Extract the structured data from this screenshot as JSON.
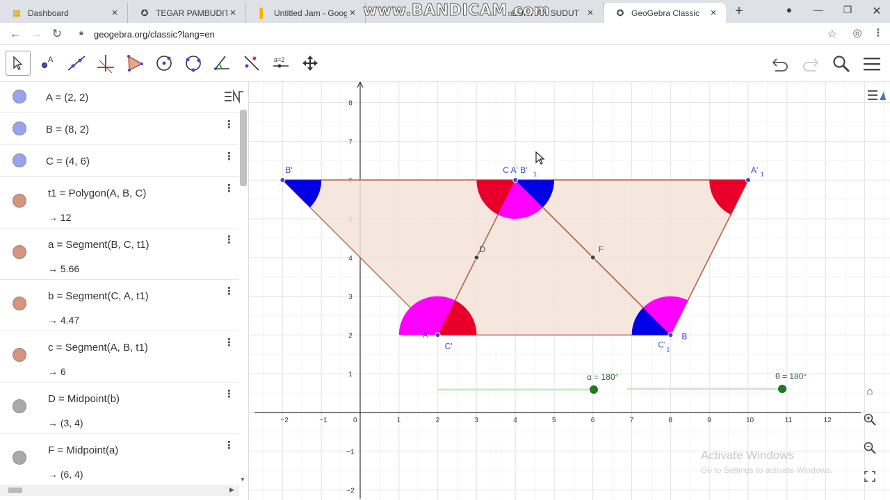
{
  "browser": {
    "tabs": [
      {
        "title": "Dashboard",
        "icon": "dashboard-icon",
        "glyph": "▦",
        "color": "#e0a800"
      },
      {
        "title": "TEGAR PAMBUDITAMA",
        "icon": "geogebra-icon",
        "glyph": "✪",
        "color": "#555555"
      },
      {
        "title": "Untitled Jam - Google",
        "icon": "jamboard-icon",
        "glyph": "▌",
        "color": "#f4b400"
      },
      {
        "title": "BUKTIAN SUDUT",
        "icon": "geogebra-icon",
        "glyph": "✪",
        "color": "#555555"
      },
      {
        "title": "GeoGebra Classic",
        "icon": "geogebra-icon",
        "glyph": "✪",
        "color": "#555555"
      }
    ],
    "watermark": "www.BANDICAM.com",
    "url": "geogebra.org/classic?lang=en"
  },
  "algebra": [
    {
      "expr": "A = (2, 2)",
      "color": "#9aa2f5",
      "value": ""
    },
    {
      "expr": "B = (8, 2)",
      "color": "#9aa2f5",
      "value": ""
    },
    {
      "expr": "C = (4, 6)",
      "color": "#9aa2f5",
      "value": ""
    },
    {
      "expr": "t1 = Polygon(A, B, C)",
      "color": "#d6947a",
      "value": "→  12"
    },
    {
      "expr": "a  = Segment(B, C, t1)",
      "color": "#d6947a",
      "value": "→  5.66"
    },
    {
      "expr": "b  = Segment(C, A, t1)",
      "color": "#d6947a",
      "value": "→  4.47"
    },
    {
      "expr": "c  = Segment(A, B, t1)",
      "color": "#d6947a",
      "value": "→  6"
    },
    {
      "expr": "D  = Midpoint(b)",
      "color": "#aaaaaa",
      "value": "→  (3, 4)"
    },
    {
      "expr": "F  = Midpoint(a)",
      "color": "#aaaaaa",
      "value": "→  (6, 4)"
    }
  ],
  "graph": {
    "x_ticks": [
      "−2",
      "−1",
      "0",
      "1",
      "2",
      "3",
      "4",
      "5",
      "6",
      "7",
      "8",
      "9",
      "10",
      "11",
      "12"
    ],
    "y_ticks": [
      "8",
      "7",
      "6",
      "5",
      "4",
      "3",
      "2",
      "1",
      "−1",
      "−2"
    ],
    "point_labels": {
      "A": "A",
      "B": "B",
      "C_A_B1": "C A' B'",
      "B1_sub": "1",
      "B_prime": "B'",
      "A1": "A'",
      "A1_sub": "1",
      "C_prime": "C'",
      "C1": "C'",
      "C1_sub": "1",
      "D": "D",
      "F": "F"
    },
    "slider_alpha": {
      "label": "α = 180°",
      "value": 180
    },
    "slider_theta": {
      "label": "θ = 180°",
      "value": 180
    },
    "colors": {
      "fill": "#f5e3d8",
      "edge": "#b86a4e",
      "red": "#e8002a",
      "blue": "#0000e8",
      "magenta": "#ff00ff",
      "slider": "#1f7a1f"
    }
  },
  "overlay": {
    "activate_title": "Activate Windows",
    "activate_sub": "Go to Settings to activate Windows."
  }
}
